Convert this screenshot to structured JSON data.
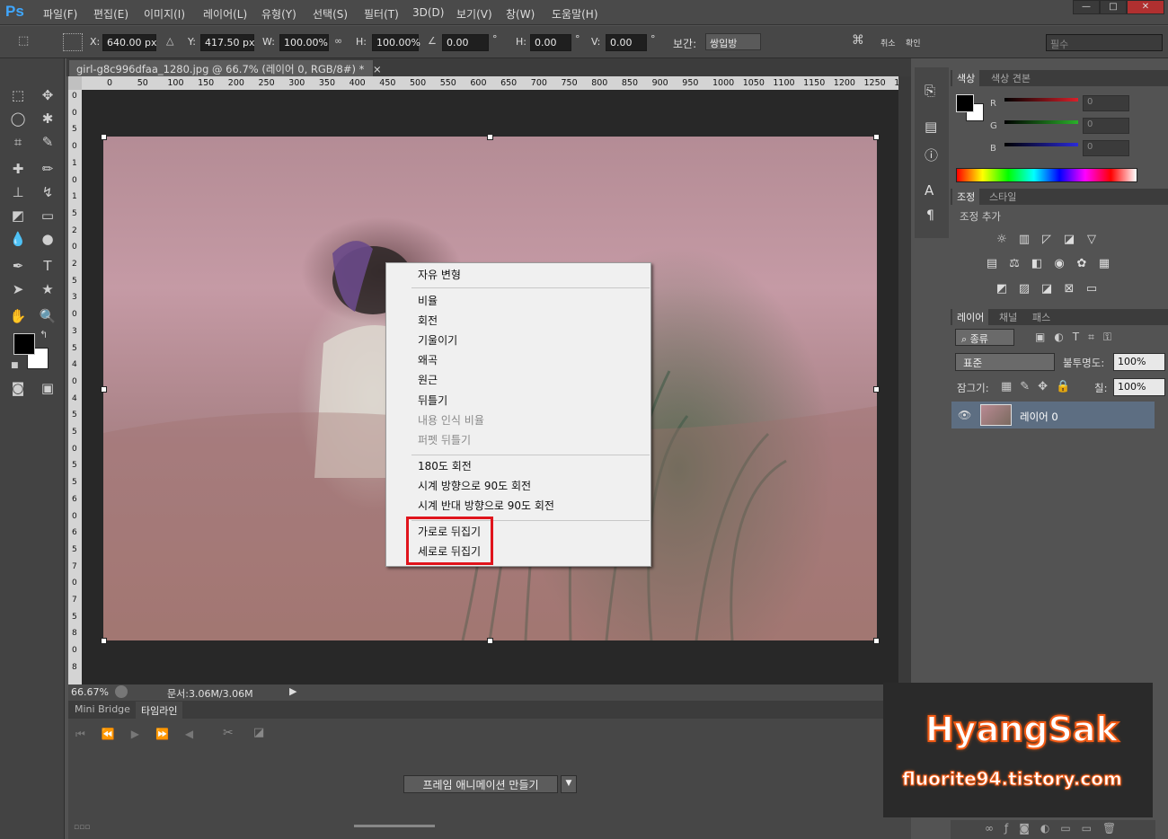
{
  "app": {
    "logo": "Ps"
  },
  "menu": [
    "파일(F)",
    "편집(E)",
    "이미지(I)",
    "레이어(L)",
    "유형(Y)",
    "선택(S)",
    "필터(T)",
    "3D(D)",
    "보기(V)",
    "창(W)",
    "도움말(H)"
  ],
  "window_controls": {
    "minimize": "—",
    "restore": "□",
    "close": "✕"
  },
  "options": {
    "x_label": "X:",
    "x_value": "640.00 px",
    "y_label": "Y:",
    "y_value": "417.50 px",
    "w_label": "W:",
    "w_value": "100.00%",
    "h_label": "H:",
    "h_value": "100.00%",
    "angle_value": "0.00",
    "angle_unit": "°",
    "hskew_label": "H:",
    "hskew_value": "0.00",
    "hskew_unit": "°",
    "vskew_label": "V:",
    "vskew_value": "0.00",
    "vskew_unit": "°",
    "interp_label": "보간:",
    "interp_value": "쌍입방",
    "cancel": "취소",
    "commit": "확인",
    "workspace": "필수"
  },
  "document": {
    "tab_title": "girl-g8c996dfaa_1280.jpg @ 66.7% (레이어 0, RGB/8#) *",
    "tab_close": "×",
    "zoom": "66.67%",
    "doc_size": "문서:3.06M/3.06M"
  },
  "ruler_h": [
    "0",
    "50",
    "100",
    "150",
    "200",
    "250",
    "300",
    "350",
    "400",
    "450",
    "500",
    "550",
    "600",
    "650",
    "700",
    "750",
    "800",
    "850",
    "900",
    "950",
    "1000",
    "1050",
    "1100",
    "1150",
    "1200",
    "1250",
    "1"
  ],
  "ruler_v": [
    "0",
    "0",
    "5",
    "0",
    "1",
    "0",
    "1",
    "5",
    "2",
    "0",
    "2",
    "5",
    "3",
    "0",
    "3",
    "5",
    "4",
    "0",
    "4",
    "5",
    "5",
    "0",
    "5",
    "5",
    "6",
    "0",
    "6",
    "5",
    "7",
    "0",
    "7",
    "5",
    "8",
    "0",
    "8"
  ],
  "context_menu": {
    "items": [
      {
        "label": "자유 변형",
        "enabled": true
      },
      {
        "label": "비율",
        "enabled": true
      },
      {
        "label": "회전",
        "enabled": true
      },
      {
        "label": "기울이기",
        "enabled": true
      },
      {
        "label": "왜곡",
        "enabled": true
      },
      {
        "label": "원근",
        "enabled": true
      },
      {
        "label": "뒤틀기",
        "enabled": true
      },
      {
        "label": "내용 인식 비율",
        "enabled": false
      },
      {
        "label": "퍼펫 뒤틀기",
        "enabled": false
      },
      {
        "label": "180도 회전",
        "enabled": true
      },
      {
        "label": "시계 방향으로 90도 회전",
        "enabled": true
      },
      {
        "label": "시계 반대 방향으로 90도 회전",
        "enabled": true
      },
      {
        "label": "가로로 뒤집기",
        "enabled": true
      },
      {
        "label": "세로로 뒤집기",
        "enabled": true
      }
    ]
  },
  "bottom_panel": {
    "tabs": [
      "Mini Bridge",
      "타임라인"
    ],
    "create_button": "프레임 애니메이션 만들기"
  },
  "color_panel": {
    "tabs": [
      "색상",
      "색상 견본"
    ],
    "r_label": "R",
    "g_label": "G",
    "b_label": "B",
    "r_value": "0",
    "g_value": "0",
    "b_value": "0",
    "colors": {
      "r": "#d8202a",
      "g": "#2ab02a",
      "b": "#2a2ad8"
    }
  },
  "adjust_panel": {
    "tabs": [
      "조정",
      "스타일"
    ],
    "title": "조정 추가"
  },
  "layers_panel": {
    "tabs": [
      "레이어",
      "채널",
      "패스"
    ],
    "filter_label": "종류",
    "blend_mode": "표준",
    "opacity_label": "불투명도:",
    "opacity_value": "100%",
    "lock_label": "잠그기:",
    "fill_label": "칠:",
    "fill_value": "100%",
    "layers": [
      {
        "name": "레이어 0"
      }
    ]
  },
  "watermark": {
    "title": "HyangSak",
    "url": "fluorite94.tistory.com"
  },
  "colors": {
    "highlight": "#e0141c",
    "accent": "#3fa7ff"
  }
}
